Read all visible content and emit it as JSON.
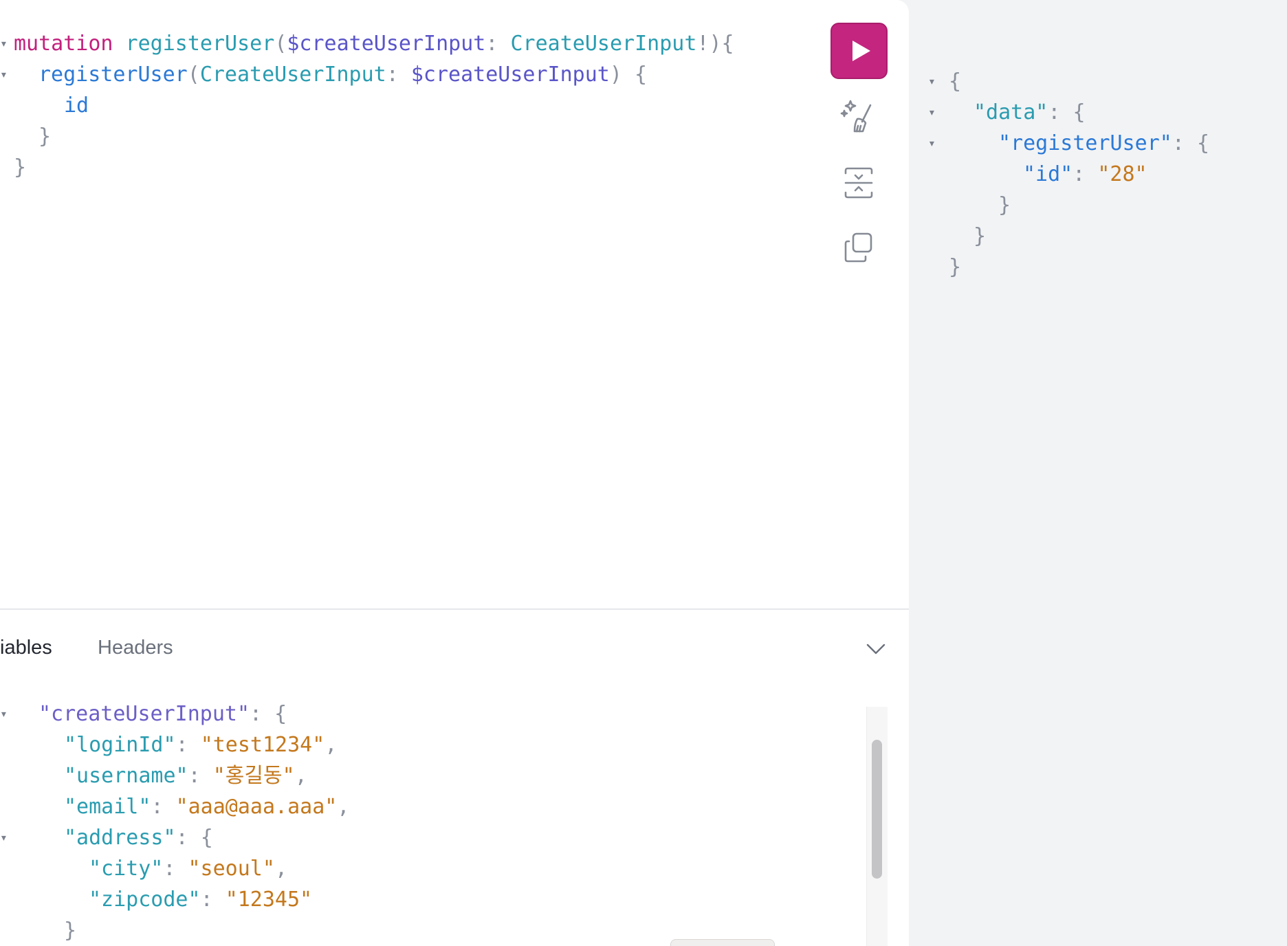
{
  "query_editor": {
    "lines": [
      {
        "parts": [
          "mutation",
          "registerUser",
          "(",
          "$createUserInput",
          ":",
          "CreateUserInput",
          "!){"
        ]
      },
      {
        "parts": [
          "registerUser",
          "(",
          "CreateUserInput",
          ":",
          "$createUserInput",
          ")",
          "{"
        ]
      },
      {
        "parts": [
          "id"
        ]
      },
      {
        "parts": [
          "}"
        ]
      },
      {
        "parts": [
          "}"
        ]
      }
    ]
  },
  "toolbar": {
    "run_icon": "play-icon",
    "prettify_icon": "magic-wand-icon",
    "merge_icon": "merge-fragments-icon",
    "copy_icon": "copy-icon"
  },
  "variables_panel": {
    "tab_variables_label": "iables",
    "tab_headers_label": "Headers",
    "collapse_icon": "chevron-down-icon",
    "lines": [
      {
        "parts": [
          "\"createUserInput\"",
          ":",
          "{"
        ]
      },
      {
        "parts": [
          "\"loginId\"",
          ":",
          "\"test1234\"",
          ","
        ]
      },
      {
        "parts": [
          "\"username\"",
          ":",
          "\"홍길동\"",
          ","
        ]
      },
      {
        "parts": [
          "\"email\"",
          ":",
          "\"aaa@aaa.aaa\"",
          ","
        ]
      },
      {
        "parts": [
          "\"address\"",
          ":",
          "{"
        ]
      },
      {
        "parts": [
          "\"city\"",
          ":",
          "\"seoul\"",
          ","
        ]
      },
      {
        "parts": [
          "\"zipcode\"",
          ":",
          "\"12345\""
        ]
      },
      {
        "parts": [
          "}"
        ]
      }
    ]
  },
  "response": {
    "lines": [
      {
        "parts": [
          "{"
        ]
      },
      {
        "parts": [
          "\"data\"",
          ":",
          "{"
        ]
      },
      {
        "parts": [
          "\"registerUser\"",
          ":",
          "{"
        ]
      },
      {
        "parts": [
          "\"id\"",
          ":",
          "\"28\""
        ]
      },
      {
        "parts": [
          "}"
        ]
      },
      {
        "parts": [
          "}"
        ]
      },
      {
        "parts": [
          "}"
        ]
      }
    ]
  },
  "colors": {
    "run_button": "#c4257f",
    "keyword": "#c2207d",
    "string": "#c4781d",
    "field": "#2b79d6",
    "type": "#2a9cb0",
    "variable": "#5a55c8"
  }
}
